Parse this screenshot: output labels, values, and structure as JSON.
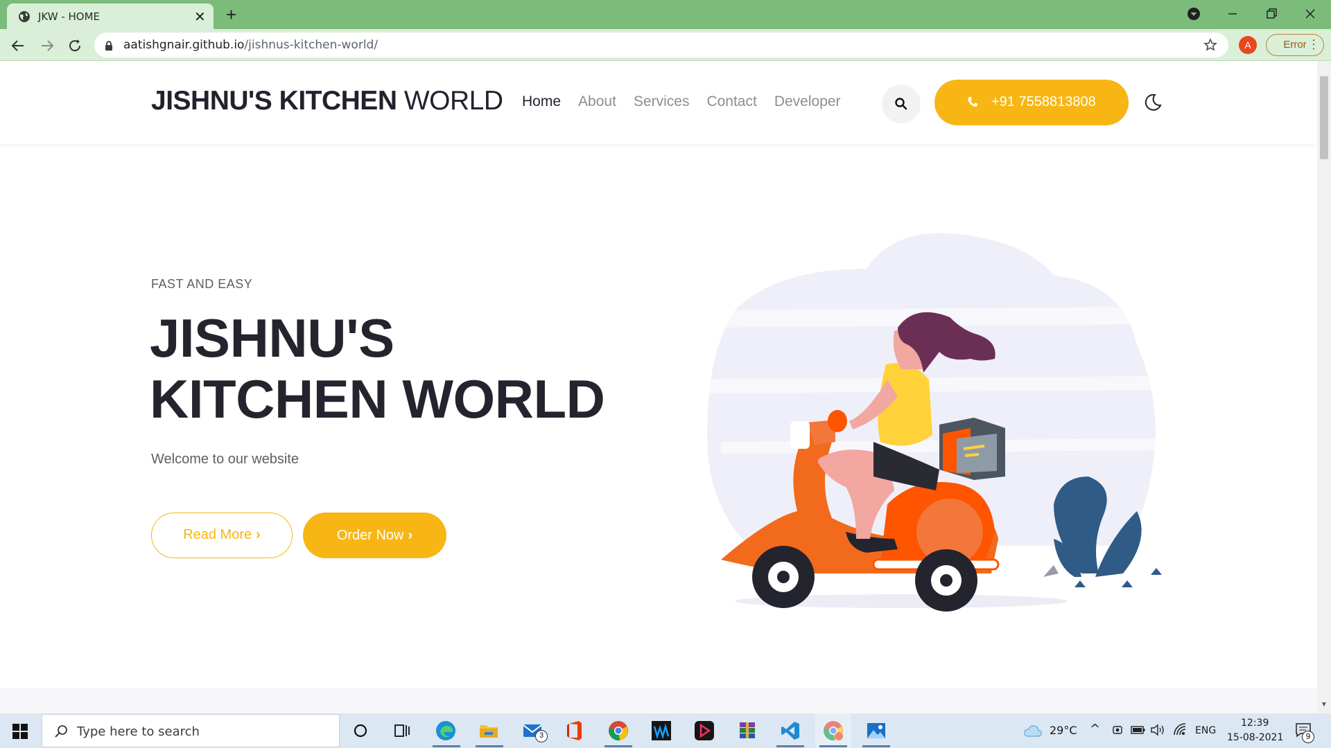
{
  "browser": {
    "tab_title": "JKW - HOME",
    "url_host": "aatishgnair.github.io",
    "url_path": "/jishnus-kitchen-world/",
    "profile_initial": "A",
    "error_label": "Error"
  },
  "site": {
    "brand_bold": "JISHNU'S KITCHEN",
    "brand_light": " WORLD",
    "nav": [
      "Home",
      "About",
      "Services",
      "Contact",
      "Developer"
    ],
    "active_nav": "Home",
    "phone": "+91 7558813808"
  },
  "hero": {
    "eyebrow": "FAST AND EASY",
    "title_line1": "JISHNU'S",
    "title_line2": "KITCHEN WORLD",
    "subtitle": "Welcome to our website",
    "read_more": "Read More",
    "order_now": "Order Now"
  },
  "taskbar": {
    "search_placeholder": "Type here to search",
    "mail_badge": "3",
    "weather": "29°C",
    "language": "ENG",
    "time": "12:39",
    "date": "15-08-2021",
    "notification_count": "9"
  },
  "colors": {
    "accent": "#f7b614",
    "chrome_green": "#7cbc7b",
    "text_dark": "#22222e"
  }
}
